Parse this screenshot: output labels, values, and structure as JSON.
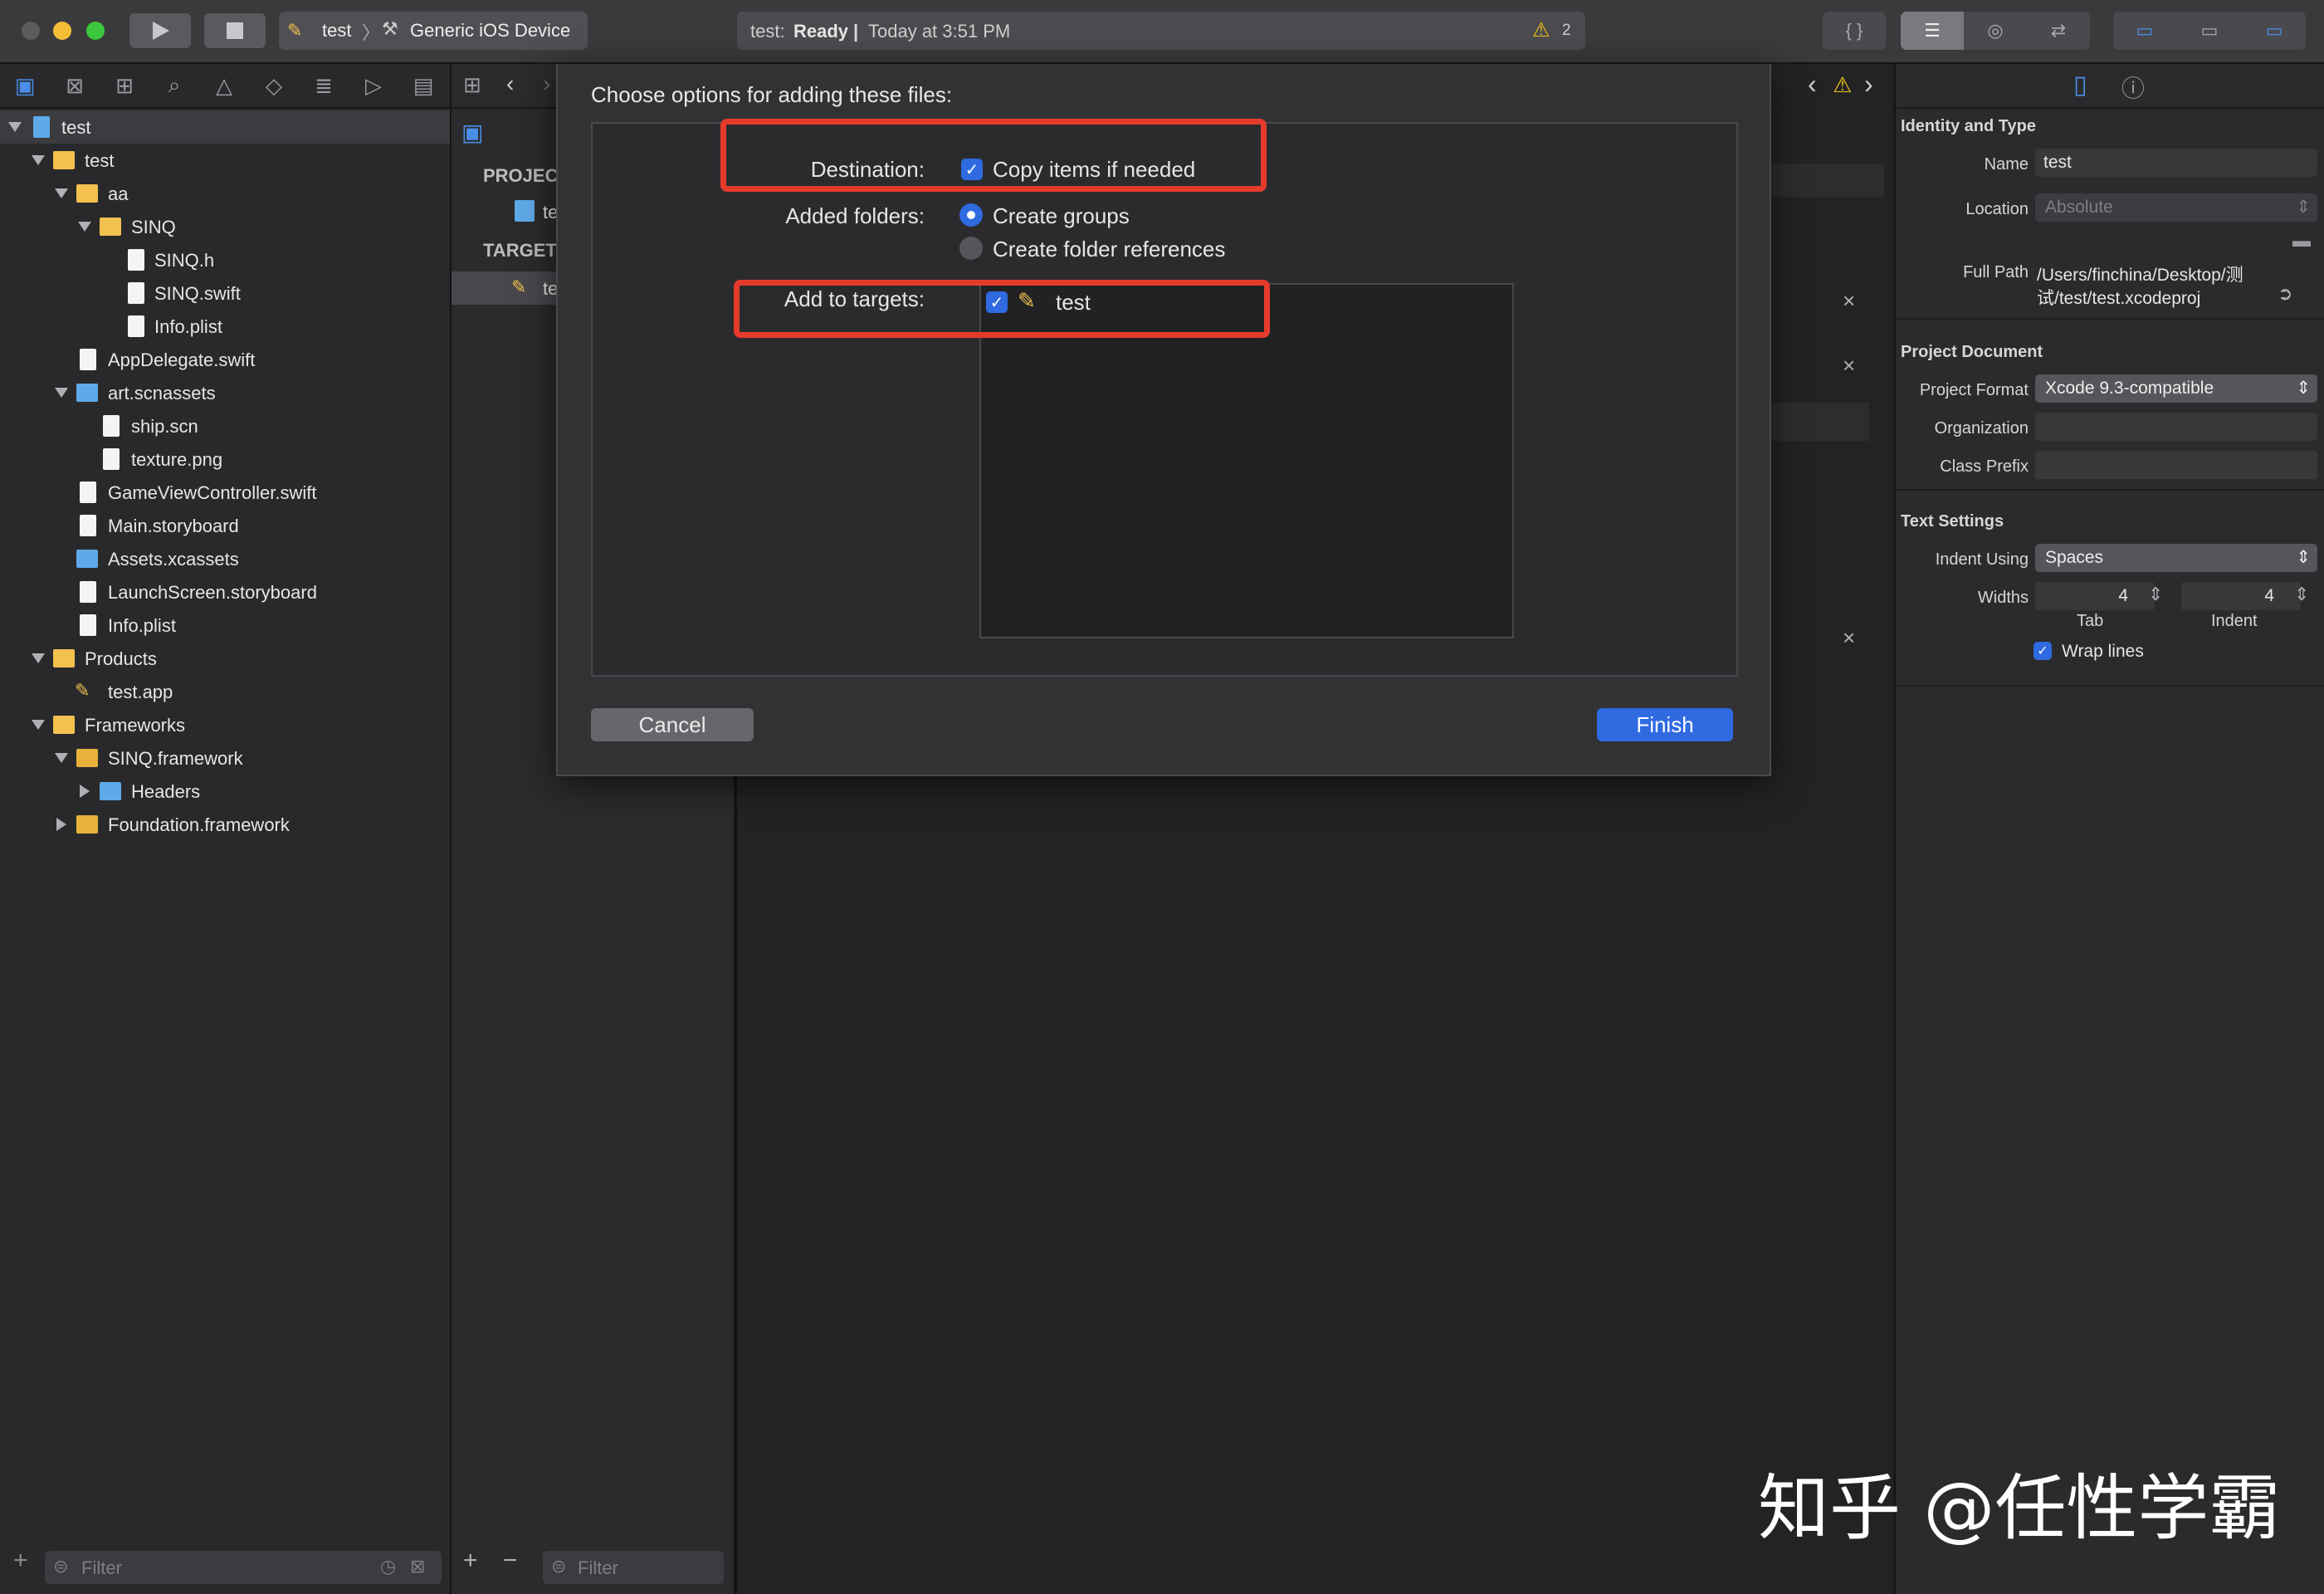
{
  "toolbar": {
    "scheme_target": "test",
    "scheme_device": "Generic iOS Device",
    "activity_project": "test:",
    "activity_status": "Ready",
    "activity_time": "Today at 3:51 PM",
    "warning_count": "2"
  },
  "navigator": {
    "tree": [
      {
        "label": "test"
      },
      {
        "label": "test"
      },
      {
        "label": "aa"
      },
      {
        "label": "SINQ"
      },
      {
        "label": "SINQ.h"
      },
      {
        "label": "SINQ.swift"
      },
      {
        "label": "Info.plist"
      },
      {
        "label": "AppDelegate.swift"
      },
      {
        "label": "art.scnassets"
      },
      {
        "label": "ship.scn"
      },
      {
        "label": "texture.png"
      },
      {
        "label": "GameViewController.swift"
      },
      {
        "label": "Main.storyboard"
      },
      {
        "label": "Assets.xcassets"
      },
      {
        "label": "LaunchScreen.storyboard"
      },
      {
        "label": "Info.plist"
      },
      {
        "label": "Products"
      },
      {
        "label": "test.app"
      },
      {
        "label": "Frameworks"
      },
      {
        "label": "SINQ.framework"
      },
      {
        "label": "Headers"
      },
      {
        "label": "Foundation.framework"
      }
    ],
    "filter_placeholder": "Filter"
  },
  "project_column": {
    "project_header": "PROJEC",
    "project_item": "te",
    "targets_header": "TARGET",
    "target_item": "te",
    "filter_placeholder": "Filter"
  },
  "sheet": {
    "title": "Choose options for adding these files:",
    "destination_label": "Destination:",
    "copy_items_label": "Copy items if needed",
    "added_folders_label": "Added folders:",
    "create_groups_label": "Create groups",
    "create_folder_refs_label": "Create folder references",
    "add_to_targets_label": "Add to targets:",
    "target_name": "test",
    "cancel_label": "Cancel",
    "finish_label": "Finish"
  },
  "inspector": {
    "identity_header": "Identity and Type",
    "name_label": "Name",
    "name_value": "test",
    "location_label": "Location",
    "location_value": "Absolute",
    "full_path_label": "Full Path",
    "full_path_line1": "/Users/finchina/Desktop/测",
    "full_path_line2": "试/test/test.xcodeproj",
    "project_doc_header": "Project Document",
    "project_format_label": "Project Format",
    "project_format_value": "Xcode 9.3-compatible",
    "organization_label": "Organization",
    "class_prefix_label": "Class Prefix",
    "text_settings_header": "Text Settings",
    "indent_using_label": "Indent Using",
    "indent_using_value": "Spaces",
    "widths_label": "Widths",
    "tab_value": "4",
    "indent_value": "4",
    "tab_caption": "Tab",
    "indent_caption": "Indent",
    "wrap_lines_label": "Wrap lines"
  },
  "watermark": "知乎 @任性学霸",
  "colors": {
    "accent": "#2f6ae0",
    "highlight_box": "#e53b2c",
    "warning": "#f5c518"
  }
}
